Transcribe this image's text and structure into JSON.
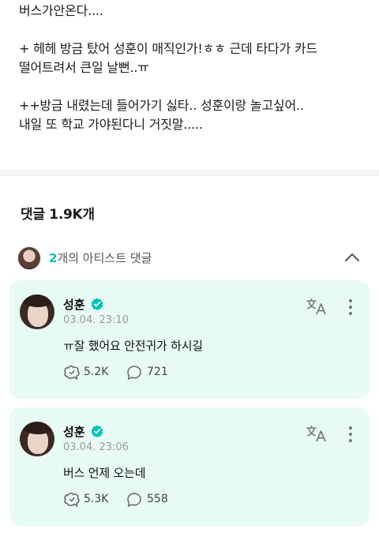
{
  "post": {
    "lines": [
      "버스가안온다....",
      "",
      "+ 헤헤 방금 탔어 성훈이 매직인가!ㅎㅎ 근데 타다가 카드",
      "떨어트려서 큰일 날뻔..ㅠ",
      "",
      "++방금 내렸는데 들어가기 싫타.. 성훈이랑 놀고싶어..",
      "내일 또 학교 가야된다니 거짓말....."
    ]
  },
  "comments_section": {
    "header": "댓글 1.9K개",
    "artist_comments": {
      "count": "2",
      "label": "개의 아티스트 댓글"
    },
    "items": [
      {
        "author": "성훈",
        "timestamp": "03.04. 23:10",
        "text": "ㅠ잘 했어요 안전귀가 하시길",
        "likes": "5.2K",
        "replies": "721"
      },
      {
        "author": "성훈",
        "timestamp": "03.04. 23:06",
        "text": "버스 언제 오는데",
        "likes": "5.3K",
        "replies": "558"
      }
    ]
  },
  "icons": {
    "verified": "verified-badge-icon",
    "translate": "translate-icon",
    "more": "more-vertical-icon",
    "like": "like-icon",
    "reply": "reply-bubble-icon",
    "collapse": "chevron-up-icon"
  },
  "colors": {
    "accent": "#00c4b3",
    "card_bg": "#e8faf6",
    "timestamp": "#9a9a9a"
  }
}
